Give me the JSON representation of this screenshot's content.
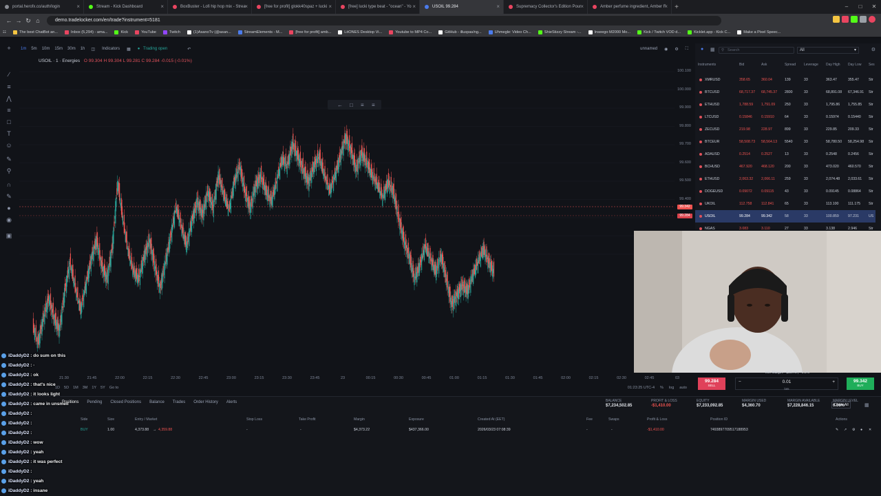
{
  "browser": {
    "tabs": [
      {
        "title": "portal.herofx.co/auth/login",
        "color": "#8a8d94",
        "active": false
      },
      {
        "title": "Stream - Kick Dashboard",
        "color": "#53fc18",
        "active": false
      },
      {
        "title": "BoxBuster - Lofi hip hop mix - Strea",
        "color": "#e94560",
        "active": false
      },
      {
        "title": "[free for profit] glokk40spaz + lucki",
        "color": "#e94560",
        "active": false
      },
      {
        "title": "[free] lucki type beat - \"ocean\" - Yo",
        "color": "#e94560",
        "active": false
      },
      {
        "title": "USOIL 99.284",
        "color": "#4b7bec",
        "active": true
      },
      {
        "title": "Supremacy Collector's Edition Pour",
        "color": "#e94560",
        "active": false
      },
      {
        "title": "Amber perfume ingredient, Amber F",
        "color": "#e94560",
        "active": false
      }
    ],
    "url": "demo.tradelocker.com/en/trade?instrument=5181",
    "bookmarks": [
      {
        "label": "The best ChatBot an...",
        "color": "#f5c542"
      },
      {
        "label": "Inbox (5,294) - ama...",
        "color": "#e94560"
      },
      {
        "label": "Kick",
        "color": "#53fc18"
      },
      {
        "label": "YouTube",
        "color": "#e94560"
      },
      {
        "label": "Twitch",
        "color": "#9146ff"
      },
      {
        "label": "(1)AsanoTv (@asan...",
        "color": "#ffffff"
      },
      {
        "label": "StreamElements - M...",
        "color": "#4b7bec"
      },
      {
        "label": "[free for profit] amb...",
        "color": "#e94560"
      },
      {
        "label": "LitONES Desktop Vi...",
        "color": "#ffffff"
      },
      {
        "label": "Youtube to MP4 Co...",
        "color": "#e94560"
      },
      {
        "label": "GitHub - illuspas/ng...",
        "color": "#ffffff"
      },
      {
        "label": "Uhmegle: Video Ch...",
        "color": "#4b7bec"
      },
      {
        "label": "ShieStizzy Stream -...",
        "color": "#53fc18"
      },
      {
        "label": "Inseego M2000 Mo...",
        "color": "#ffffff"
      },
      {
        "label": "Kick / Twitch VOD d...",
        "color": "#53fc18"
      },
      {
        "label": "Kicklet.app - Kick C...",
        "color": "#53fc18"
      },
      {
        "label": "Make a Pixel Speec...",
        "color": "#ffffff"
      }
    ]
  },
  "chart": {
    "timeframes": [
      "1m",
      "5m",
      "10m",
      "15m",
      "30m",
      "1h"
    ],
    "indicators_label": "Indicators",
    "trading_status": "Trading open",
    "layout_name": "unnamed",
    "symbol": "USOIL · 1 · Energies",
    "ohlc": "O 99.304  H 99.304  L 99.281  C 99.284  -0.015 (-0.01%)",
    "price_labels": [
      "100.100",
      "100.000",
      "99.900",
      "99.800",
      "99.700",
      "99.600",
      "99.500",
      "99.400",
      "99.300",
      "99.200",
      "99.100"
    ],
    "ask_badge": "99.342",
    "bid_badge": "99.284",
    "time_labels": [
      "21:30",
      "21:45",
      "22:00",
      "22:15",
      "22:30",
      "22:45",
      "23:00",
      "23:15",
      "23:30",
      "23:45",
      "23",
      "00:15",
      "00:30",
      "00:45",
      "01:00",
      "01:15",
      "01:30",
      "01:45",
      "02:00",
      "02:15",
      "02:30",
      "02:45",
      "03"
    ],
    "ranges": [
      "1D",
      "5D",
      "1M",
      "3M",
      "1Y",
      "5Y",
      "Go to"
    ],
    "timezone": "01:23:25 UTC-4",
    "axis_opts": [
      "%",
      "log",
      "auto"
    ],
    "series": [
      99.13,
      99.08,
      99.16,
      99.22,
      99.16,
      99.12,
      99.24,
      99.33,
      99.25,
      99.18,
      99.26,
      99.34,
      99.4,
      99.32,
      99.28,
      99.38,
      99.58,
      99.46,
      99.36,
      99.3,
      99.28,
      99.35,
      99.4,
      99.32,
      99.25,
      99.33,
      99.41,
      99.5,
      99.44,
      99.38,
      99.46,
      99.52,
      99.48,
      99.55,
      99.5,
      99.6,
      99.54,
      99.49,
      99.58,
      99.63,
      99.55,
      99.5,
      99.57,
      99.6,
      99.55,
      99.52,
      99.58,
      99.65,
      99.63,
      99.7,
      99.66,
      99.62,
      99.58,
      99.63,
      99.66,
      99.6,
      99.55,
      99.6,
      99.66,
      99.72,
      99.68,
      99.62,
      99.67,
      99.64,
      99.6,
      99.57,
      99.53,
      99.58,
      99.55,
      99.47,
      99.4,
      99.35,
      99.28,
      99.32,
      99.38,
      99.34,
      99.3,
      99.35,
      99.28,
      99.2,
      99.23,
      99.26,
      99.24,
      99.29,
      99.33,
      99.37,
      99.33,
      99.3
    ]
  },
  "watchlist": {
    "search_placeholder": "Search",
    "filter": "All",
    "headers": [
      "Instruments",
      "Bid",
      "Ask",
      "Spread",
      "Leverage",
      "Day High",
      "Day Low",
      "Ses"
    ],
    "rows": [
      {
        "symbol": "XMRUSD",
        "bid": "358.65",
        "ask": "360.04",
        "spread": "139",
        "lev": "33",
        "high": "363.47",
        "low": "355.47",
        "dir": "Str",
        "sel": false
      },
      {
        "symbol": "BTCUSD",
        "bid": "68,717.37",
        "ask": "68,745.37",
        "spread": "2800",
        "lev": "33",
        "high": "68,891.08",
        "low": "67,346.91",
        "dir": "Str",
        "sel": false
      },
      {
        "symbol": "ETHUSD",
        "bid": "1,788.59",
        "ask": "1,791.09",
        "spread": "250",
        "lev": "33",
        "high": "1,795.86",
        "low": "1,755.85",
        "dir": "Str",
        "sel": false
      },
      {
        "symbol": "LTCUSD",
        "bid": "0.15846",
        "ask": "0.15910",
        "spread": "64",
        "lev": "33",
        "high": "0.15974",
        "low": "0.15440",
        "dir": "Str",
        "sel": false
      },
      {
        "symbol": "ZECUSD",
        "bid": "219.98",
        "ask": "228.97",
        "spread": "899",
        "lev": "33",
        "high": "229.85",
        "low": "209.33",
        "dir": "Str",
        "sel": false
      },
      {
        "symbol": "BTCEUR",
        "bid": "58,508.73",
        "ask": "58,564.13",
        "spread": "5540",
        "lev": "33",
        "high": "58,780.50",
        "low": "58,254.98",
        "dir": "Str",
        "sel": false
      },
      {
        "symbol": "ADAUSD",
        "bid": "0.2514",
        "ask": "0.2527",
        "spread": "13",
        "lev": "33",
        "high": "0.2548",
        "low": "0.2456",
        "dir": "Str",
        "sel": false
      },
      {
        "symbol": "BCHUSD",
        "bid": "467.920",
        "ask": "468.120",
        "spread": "200",
        "lev": "33",
        "high": "473.020",
        "low": "460.570",
        "dir": "Str",
        "sel": false
      },
      {
        "symbol": "ETHUSD",
        "bid": "2,063.32",
        "ask": "2,066.11",
        "spread": "259",
        "lev": "33",
        "high": "2,074.48",
        "low": "2,033.61",
        "dir": "Str",
        "sel": false
      },
      {
        "symbol": "DOGEUSD",
        "bid": "0.09072",
        "ask": "0.09115",
        "spread": "43",
        "lev": "33",
        "high": "0.09145",
        "low": "0.08864",
        "dir": "Str",
        "sel": false
      },
      {
        "symbol": "UKOIL",
        "bid": "112.758",
        "ask": "112.841",
        "spread": "65",
        "lev": "33",
        "high": "113.100",
        "low": "111.175",
        "dir": "Str",
        "sel": false
      },
      {
        "symbol": "USOIL",
        "bid": "99.284",
        "ask": "99.342",
        "spread": "58",
        "lev": "33",
        "high": "100.859",
        "low": "97.231",
        "dir": "US",
        "sel": true
      },
      {
        "symbol": "NGAS",
        "bid": "3.083",
        "ask": "3.110",
        "spread": "27",
        "lev": "33",
        "high": "3.138",
        "low": "2.946",
        "dir": "Str",
        "sel": false
      }
    ]
  },
  "order_panel": {
    "sell_price": "99.284",
    "sell_label": "SELL",
    "buy_price": "99.342",
    "buy_label": "BUY",
    "quantity": "0.01",
    "quantity_label": "lots",
    "margin_caption": "Init. Margin: ~$29.79 | ~0.0%"
  },
  "positions": {
    "tabs": [
      "Positions",
      "Pending",
      "Closed Positions",
      "Balance",
      "Trades",
      "Order History",
      "Alerts"
    ],
    "stats": [
      {
        "label": "BALANCE",
        "value": "$7,234,502.85"
      },
      {
        "label": "PROFIT & LOSS",
        "value": "-$1,410.00"
      },
      {
        "label": "EQUITY",
        "value": "$7,233,092.85"
      },
      {
        "label": "MARGIN USED",
        "value": "$4,360.70"
      },
      {
        "label": "MARGIN AVAILABLE",
        "value": "$7,228,846.15"
      },
      {
        "label": "MARGIN LEVEL",
        "value": "0.06%"
      }
    ],
    "close_all": "Close All",
    "headers": [
      "Side",
      "Size",
      "Entry / Market",
      "Stop Loss",
      "Take Profit",
      "Margin",
      "Exposure",
      "Created At (EET)",
      "Fee",
      "Swaps",
      "Profit & Loss",
      "Position ID",
      "Actions"
    ],
    "row": {
      "side": "BUY",
      "size": "1.00",
      "entry": "4,373.88",
      "arrow": "→",
      "market": "4,359.88",
      "sl": "-",
      "tp": "-",
      "margin": "$4,373.22",
      "exposure": "$437,366.00",
      "created": "2026/03/23 07:08:39",
      "fee": "-",
      "swaps": "-",
      "pnl": "-$1,410.00",
      "id": "7493897709517188953"
    }
  },
  "webcam": {
    "caption": "Init. Margin: ~$29.79"
  },
  "chat": [
    {
      "user": "iDaddyD2",
      "message": "do sum on this"
    },
    {
      "user": "iDaddyD2",
      "message": "·"
    },
    {
      "user": "iDaddyD2",
      "message": "ok"
    },
    {
      "user": "iDaddyD2",
      "message": "that's nice"
    },
    {
      "user": "iDaddyD2",
      "message": "it looks light"
    },
    {
      "user": "iDaddyD2",
      "message": "came in unsmell"
    },
    {
      "user": "iDaddyD2",
      "message": ""
    },
    {
      "user": "iDaddyD2",
      "message": ""
    },
    {
      "user": "iDaddyD2",
      "message": ""
    },
    {
      "user": "iDaddyD2",
      "message": "wow"
    },
    {
      "user": "iDaddyD2",
      "message": "yeah"
    },
    {
      "user": "iDaddyD2",
      "message": "it was perfect"
    },
    {
      "user": "iDaddyD2",
      "message": ""
    },
    {
      "user": "iDaddyD2",
      "message": "yeah"
    },
    {
      "user": "iDaddyD2",
      "message": "insane"
    }
  ],
  "colors": {
    "up": "#26a69a",
    "down": "#ef5350",
    "accent": "#2962ff",
    "sell": "#e0415a",
    "buy": "#1fae5a"
  }
}
